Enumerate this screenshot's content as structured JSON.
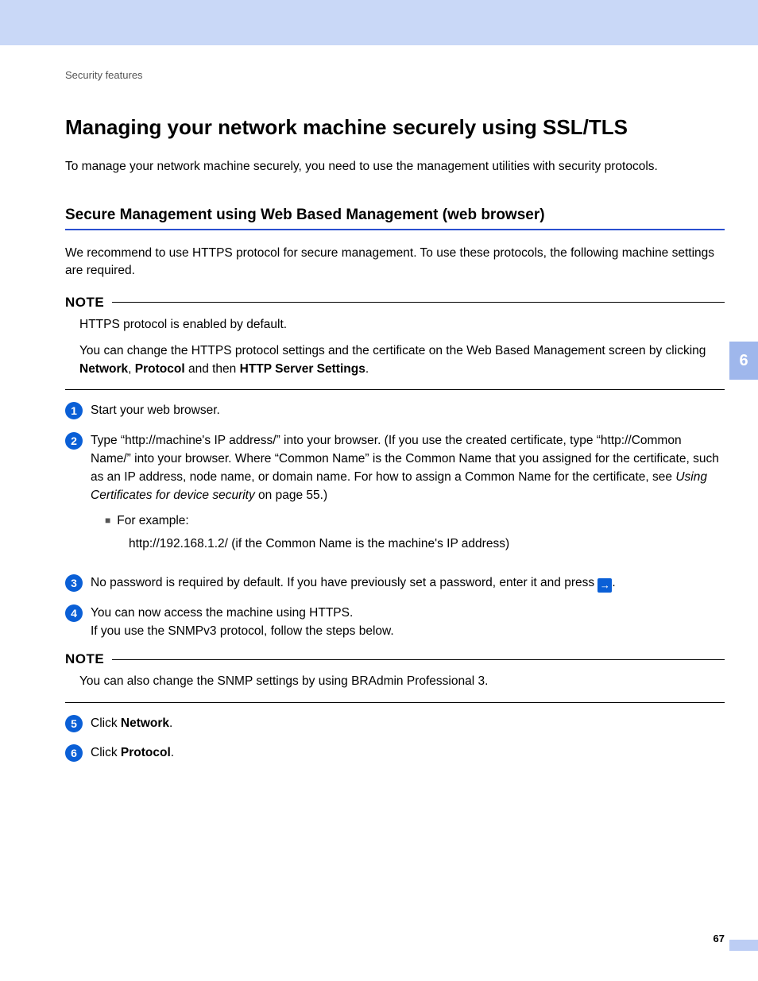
{
  "breadcrumb": "Security features",
  "title": "Managing your network machine securely using SSL/TLS",
  "intro": "To manage your network machine securely, you need to use the management utilities with security protocols.",
  "section_heading": "Secure Management using Web Based Management (web browser)",
  "section_intro": "We recommend to use HTTPS protocol for secure management. To use these protocols, the following machine settings are required.",
  "note1": {
    "label": "NOTE",
    "line1": "HTTPS protocol is enabled by default.",
    "line2_pre": "You can change the HTTPS protocol settings and the certificate on the Web Based Management screen by clicking ",
    "b1": "Network",
    "c1": ", ",
    "b2": "Protocol",
    "c2": " and then ",
    "b3": "HTTP Server Settings",
    "c3": "."
  },
  "steps": {
    "s1": "Start your web browser.",
    "s2_a": "Type “http://machine's IP address/” into your browser. (If you use the created certificate, type “http://Common Name/” into your browser. Where “Common Name” is the Common Name that you assigned for the certificate, such as an IP address, node name, or domain name. For how to assign a Common Name for the certificate, see ",
    "s2_link": "Using Certificates for device security",
    "s2_b": " on page 55.)",
    "s2_sub_label": "For example:",
    "s2_sub_example": "http://192.168.1.2/ (if the Common Name is the machine's IP address)",
    "s3_a": "No password is required by default. If you have previously set a password, enter it and press ",
    "s3_b": ".",
    "s4_a": "You can now access the machine using HTTPS.",
    "s4_b": "If you use the SNMPv3 protocol, follow the steps below.",
    "s5_pre": "Click ",
    "s5_bold": "Network",
    "s5_post": ".",
    "s6_pre": "Click ",
    "s6_bold": "Protocol",
    "s6_post": "."
  },
  "note2": {
    "label": "NOTE",
    "line1": "You can also change the SNMP settings by using BRAdmin Professional 3."
  },
  "side_tab": "6",
  "page_number": "67"
}
